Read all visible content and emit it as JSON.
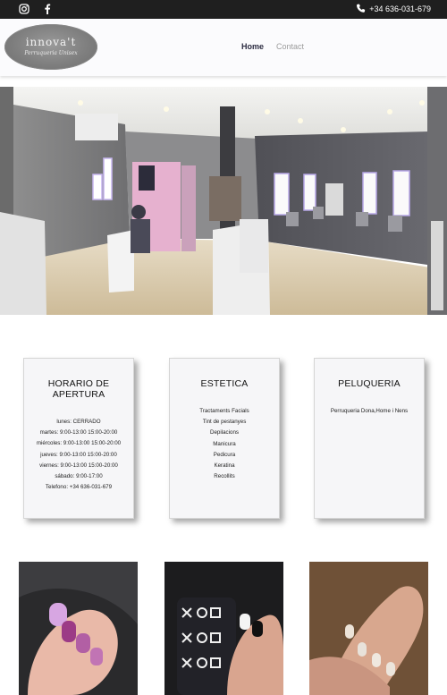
{
  "topbar": {
    "social_icons": [
      "instagram-icon",
      "facebook-icon"
    ],
    "phone_icon": "phone-icon",
    "phone": "+34 636-031-679"
  },
  "header": {
    "logo": {
      "brand": "innova't",
      "tagline": "Perruqueria Unisex"
    },
    "nav": [
      {
        "label": "Home",
        "active": true
      },
      {
        "label": "Contact",
        "active": false
      }
    ]
  },
  "cards": [
    {
      "title": "HORARIO DE APERTURA",
      "lines": [
        "lunes: CERRADO",
        "martes: 9:00-13:00 15:00-20:00",
        "miércoles: 9:00-13:00 15:00-20:00",
        "jueves: 9:00-13:00 15:00-20:00",
        "viernes: 9:00-13:00 15:00-20:00",
        "sábado: 9:00-17:00",
        "Telefono: +34 636-031-679"
      ]
    },
    {
      "title": "ESTETICA",
      "lines": [
        "Tractaments Facials",
        "Tint de pestanyes",
        "Depilacions",
        "Manicura",
        "Pedicura",
        "Keratina",
        "Recollits"
      ]
    },
    {
      "title": "PELUQUERIA",
      "lines": [
        "Perruqueria Dona,Home i Nens"
      ]
    }
  ],
  "colors": {
    "topbar": "#1f1f1f",
    "header_bg": "#fbfbfd",
    "nav_active": "#2a2a40",
    "nav_inactive": "#9b9b9b",
    "card_bg": "#f6f6f8"
  }
}
